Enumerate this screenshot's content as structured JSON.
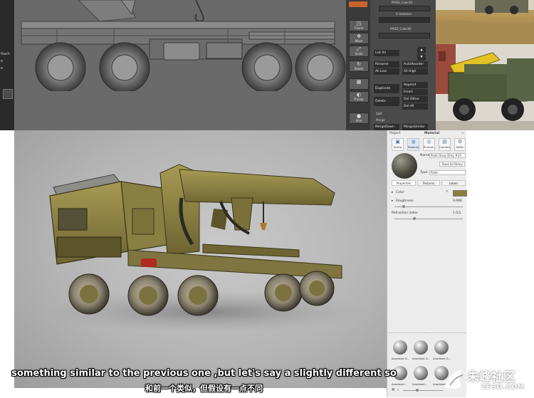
{
  "zbrush": {
    "left_text": [
      "ttach",
      "o",
      "e"
    ],
    "tool_buttons": [
      {
        "label": "Frame",
        "icon": "frame-icon"
      },
      {
        "label": "Move",
        "icon": "move-icon"
      },
      {
        "label": "Scale",
        "icon": "scale-icon"
      },
      {
        "label": "Rotate",
        "icon": "rotate-icon"
      },
      {
        "label": "",
        "icon": "wireframe-icon"
      },
      {
        "label": "Transp",
        "icon": "transp-icon"
      },
      {
        "label": "Solo",
        "icon": "solo-icon"
      }
    ],
    "subtool": {
      "field_1": "PM3D_Cube3D",
      "in_between": "In between",
      "field_2": "PM3D_Cube3D",
      "list_all": "List All",
      "rename": "Rename",
      "autoreorder": "AutoReorder",
      "all_low": "All Low",
      "all_high": "All High",
      "append": "Append",
      "duplicate": "Duplicate",
      "insert": "Insert",
      "delete": "Delete",
      "del_other": "Del Other",
      "del_all": "Del All",
      "split": "Split",
      "merge": "Merge",
      "mergedown": "MergeDown",
      "mergesimilar": "MergeSimilar"
    }
  },
  "props": {
    "tabs": [
      "Project",
      "Material"
    ],
    "icon_tabs": [
      {
        "label": "Scene",
        "icon": "scene-icon"
      },
      {
        "label": "Material",
        "icon": "material-icon"
      },
      {
        "label": "Environ...",
        "icon": "environment-icon"
      },
      {
        "label": "Camera",
        "icon": "camera-icon"
      },
      {
        "label": "Settin",
        "icon": "settings-icon"
      }
    ],
    "name_label": "Name:",
    "name_value": "Paint Gloss Dirty #10",
    "save_library": "Save to library",
    "type_label": "Type:",
    "type_value": "Paint",
    "subtabs": [
      "Properties",
      "Textures",
      "Labels"
    ],
    "color_label": "Color",
    "color_value": "#8b7f3e",
    "roughness_label": "Roughness",
    "roughness_value": "0.066",
    "refraction_label": "Refraction index",
    "refraction_value": "1.5/1",
    "materials_top": [
      "Anodized G...",
      "Anodized G...",
      "Anodized G..."
    ],
    "materials_bottom": [
      "Anodized...",
      "Anodized...",
      "Anodized..."
    ]
  },
  "subtitles": {
    "english": "something similar to the previous one ,but let's say a slightly different so",
    "chinese": "和前一个类似，但假设有一点不同"
  },
  "watermark": {
    "text": "朱峰社区",
    "url": "ZF3D.COM"
  },
  "colors": {
    "truck_body": "#8b7f3e",
    "viewport_bg": "#6a6a6a",
    "render_bg": "#b5b5b5"
  }
}
